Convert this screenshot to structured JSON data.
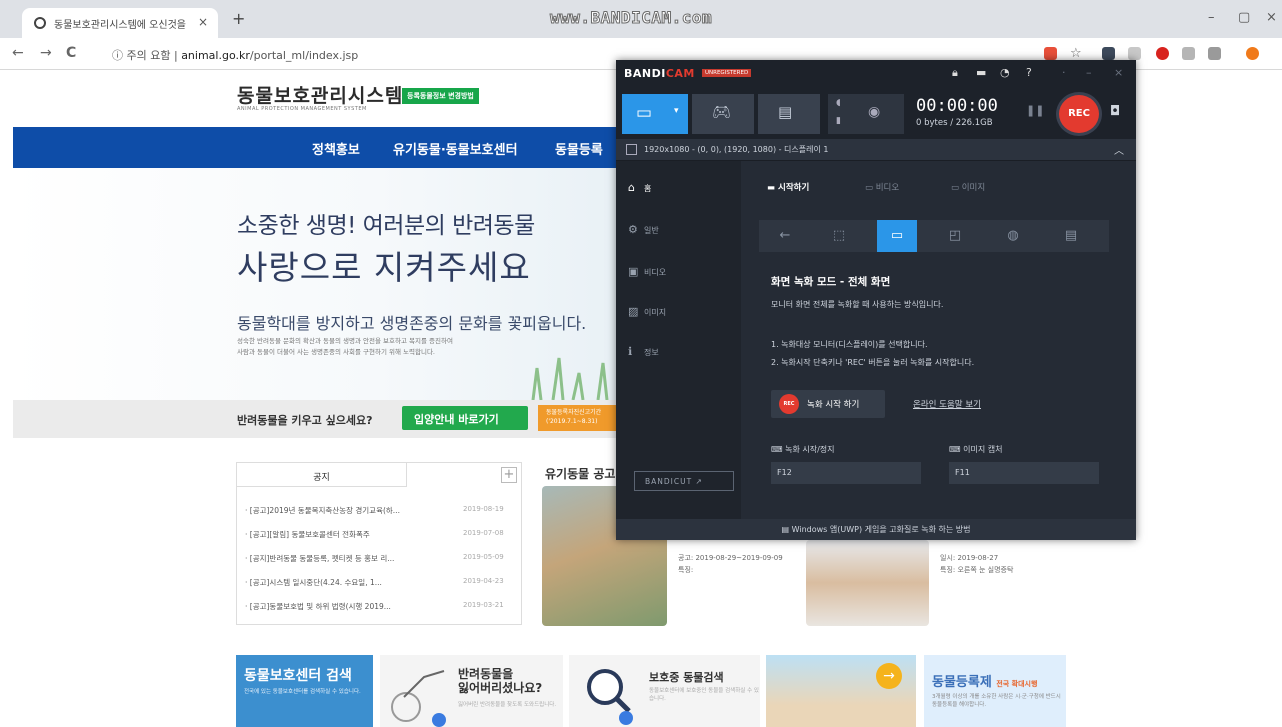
{
  "browser": {
    "tab_title": "동물보호관리시스템에 오신것을",
    "tab_close": "×",
    "new_tab": "+",
    "watermark": "www.BANDICAM.com",
    "address_warning": "주의 요함",
    "address_host": "animal.go.kr",
    "address_path": "/portal_ml/index.jsp",
    "nav_back": "←",
    "nav_forward": "→",
    "nav_reload": "C"
  },
  "site": {
    "logo": "동물보호관리시스템",
    "logo_sub": "ANIMAL PROTECTION MANAGEMENT SYSTEM",
    "badge": "등록동물정보 변경방법",
    "nav": [
      "정책홍보",
      "유기동물·동물보호센터",
      "동물등록"
    ],
    "hero_line1": "소중한 생명! 여러분의 반려동물",
    "hero_line2": "사랑으로 지켜주세요",
    "hero_line3": "동물학대를 방지하고 생명존중의 문화를 꽃피웁니다.",
    "hero_small1": "성숙한 반려동물 문화의 확산과 동물의 생명과 안전을 보호하고 복지를 증진하여",
    "hero_small2": "사람과 동물이 더불어 사는 생명존중의 사회를 구현하기 위해 노력합니다.",
    "adopt_question": "반려동물을 키우고 싶으세요?",
    "adopt_button": "입양안내 바로가기",
    "orange_badge_1": "동물등록자진신고기간",
    "orange_badge_2": "('2019.7.1~8.31)",
    "notice_tab": "공지",
    "notice_plus": "+",
    "notices": [
      {
        "title": "· [공고]2019년 동물복지축산농장 경기교육(하...",
        "date": "2019-08-19"
      },
      {
        "title": "· [공고][알림] 동물보호콜센터 전화폭주",
        "date": "2019-07-08"
      },
      {
        "title": "· [공지]반려동물 동물등록, 펫티켓 등 홍보 리...",
        "date": "2019-05-09"
      },
      {
        "title": "· [공고]시스템 일시중단(4.24. 수요일, 1...",
        "date": "2019-04-23"
      },
      {
        "title": "· [공고]동물보호법 및 하위 법령(시행 2019...",
        "date": "2019-03-21"
      }
    ],
    "lost_heading": "유기동물 공고",
    "dog1_info": [
      "공고: 2019-08-29~2019-09-09",
      "특징:"
    ],
    "dog2_info": [
      "일시: 2019-08-27",
      "특징: 오른쪽 눈 실명증탁"
    ],
    "card1_title": "동물보호센터 검색",
    "card1_sub": "전국에 있는 동물보호센터를 검색하실 수 있습니다.",
    "card2_title1": "반려동물을",
    "card2_title2": "잃어버리셨나요?",
    "card2_sub": "잃어버린 반려동물을 찾도록 도와드립니다.",
    "card3_title": "보호중 동물검색",
    "card3_sub": "동물보호센터에 보호중인 동물을 검색하실 수 있습니다.",
    "card5_title": "동물등록제",
    "card5_title_small": "전국 확대시행",
    "card5_sub": "3개월령 이상의 개를 소유한 사람은 시·군·구청에 반드시 동물등록을 해야합니다."
  },
  "bandicam": {
    "logo_a": "BANDI",
    "logo_b": "CAM",
    "unregistered": "UNREGISTERED",
    "timer": "00:00:00",
    "size": "0 bytes / 226.1GB",
    "rec_label": "REC",
    "area_text": "1920x1080 - (0, 0), (1920, 1080) - 디스플레이 1",
    "sidebar": [
      {
        "icon": "home",
        "label": "홈"
      },
      {
        "icon": "gear",
        "label": "일반"
      },
      {
        "icon": "video",
        "label": "비디오"
      },
      {
        "icon": "image",
        "label": "이미지"
      },
      {
        "icon": "info",
        "label": "정보"
      }
    ],
    "bandicut": "BANDICUT ↗",
    "tabs": [
      "시작하기",
      "비디오",
      "이미지"
    ],
    "mode_heading": "화면 녹화 모드 - 전체 화면",
    "mode_desc": "모니터 화면 전체를 녹화할 때 사용하는 방식입니다.",
    "step1": "1. 녹화대상 모니터(디스플레이)를 선택합니다.",
    "step2": "2. 녹화시작 단축키나 'REC' 버튼을 눌러 녹화를 시작합니다.",
    "start_button": "녹화 시작 하기",
    "start_dot": "REC",
    "help_link": "온라인 도움말 보기",
    "hotkey1_label": "녹화 시작/정지",
    "hotkey1_value": "F12",
    "hotkey2_label": "이미지 캡처",
    "hotkey2_value": "F11",
    "footer": "Windows 앱(UWP) 게임을 고화질로 녹화 하는 방법"
  }
}
